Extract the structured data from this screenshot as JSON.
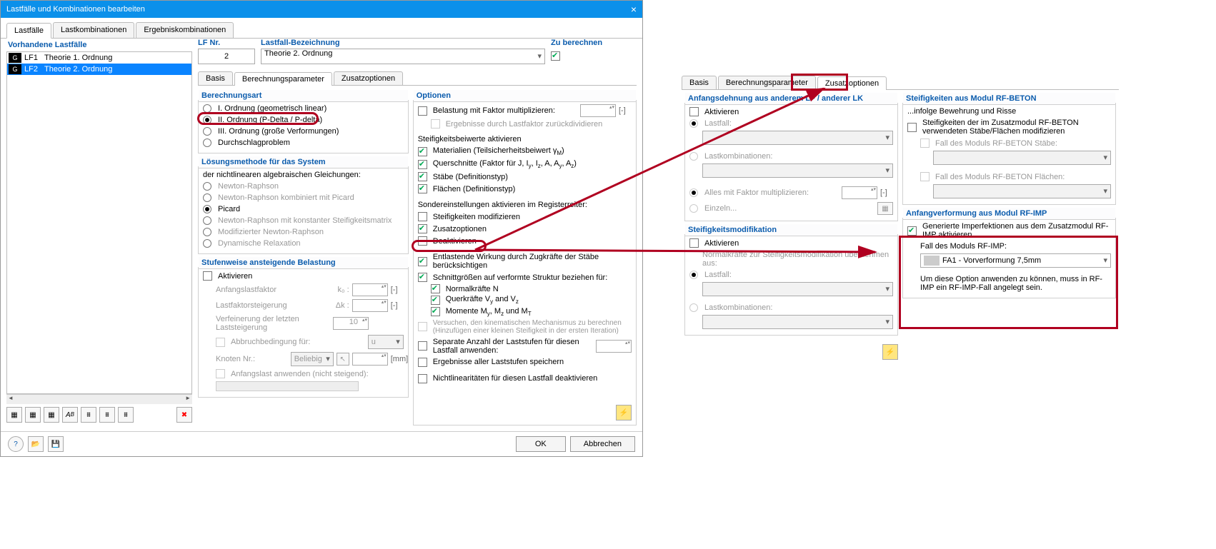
{
  "window": {
    "title": "Lastfälle und Kombinationen bearbeiten"
  },
  "tabs": {
    "t1": "Lastfälle",
    "t2": "Lastkombinationen",
    "t3": "Ergebniskombinationen"
  },
  "left": {
    "title": "Vorhandene Lastfälle",
    "badge": "G",
    "lf1_num": "LF1",
    "lf1_name": "Theorie 1. Ordnung",
    "lf2_num": "LF2",
    "lf2_name": "Theorie 2. Ordnung"
  },
  "hdr": {
    "lfnr_label": "LF Nr.",
    "lfnr_val": "2",
    "bez_label": "Lastfall-Bezeichnung",
    "bez_val": "Theorie 2. Ordnung",
    "zub_label": "Zu berechnen"
  },
  "subtabs": {
    "s1": "Basis",
    "s2": "Berechnungsparameter",
    "s3": "Zusatzoptionen"
  },
  "calc": {
    "legend": "Berechnungsart",
    "r1": "I. Ordnung (geometrisch linear)",
    "r2": "II. Ordnung (P-Delta / P-delta)",
    "r3": "III. Ordnung (große Verformungen)",
    "r4": "Durchschlagproblem"
  },
  "solver": {
    "legend": "Lösungsmethode für das System",
    "intro": "der nichtlinearen algebraischen Gleichungen:",
    "o1": "Newton-Raphson",
    "o2": "Newton-Raphson kombiniert mit Picard",
    "o3": "Picard",
    "o4": "Newton-Raphson mit konstanter Steifigkeitsmatrix",
    "o5": "Modifizierter Newton-Raphson",
    "o6": "Dynamische Relaxation"
  },
  "stuf": {
    "legend": "Stufenweise ansteigende Belastung",
    "act": "Aktivieren",
    "l1": "Anfangslastfaktor",
    "l1s": "k₀ :",
    "l2": "Lastfaktorsteigerung",
    "l2s": "Δk :",
    "l3": "Verfeinerung der letzten Laststeigerung",
    "l3v": "10",
    "l4": "Abbruchbedingung für:",
    "l4v": "u",
    "l5": "Knoten Nr.:",
    "l5v": "Beliebig",
    "l5u": "[mm]",
    "l6": "Anfangslast anwenden (nicht steigend):"
  },
  "opt": {
    "legend": "Optionen",
    "o1": "Belastung mit Faktor multiplizieren:",
    "o1b": "Ergebnisse durch Lastfaktor zurückdividieren",
    "sh": "Steifigkeitsbeiwerte aktivieren",
    "s1": "Materialien (Teilsicherheitsbeiwert γ",
    "s1sub": "M",
    "s1e": ")",
    "s2a": "Querschnitte (Faktor für J, I",
    "s2b": ", A, A",
    "s2c": ")",
    "s3": "Stäbe (Definitionstyp)",
    "s4": "Flächen (Definitionstyp)",
    "sh2": "Sondereinstellungen aktivieren im Registerreiter:",
    "t1": "Steifigkeiten modifizieren",
    "t2": "Zusatzoptionen",
    "t3": "Deaktivieren",
    "e1": "Entlastende Wirkung durch Zugkräfte der Stäbe berücksichtigen",
    "e2": "Schnittgrößen auf verformte Struktur beziehen für:",
    "e2a": "Normalkräfte N",
    "e2b": "Querkräfte V",
    "e2c": "Momente M",
    "e3": "Versuchen, den kinematischen Mechanismus zu berechnen (Hinzufügen einer kleinen Steifigkeit in der ersten Iteration)",
    "e4": "Separate Anzahl der Laststufen für diesen Lastfall anwenden:",
    "e5": "Ergebnisse aller Laststufen speichern",
    "e6": "Nichtlinearitäten für diesen Lastfall deaktivieren"
  },
  "footer": {
    "ok": "OK",
    "cancel": "Abbrechen"
  },
  "side": {
    "t1": "Basis",
    "t2": "Berechnungsparameter",
    "t3": "Zusatzoptionen",
    "g1": {
      "legend": "Anfangsdehnung aus anderem LF / anderer LK",
      "act": "Aktivieren",
      "r1": "Lastfall:",
      "r2": "Lastkombinationen:",
      "r3": "Alles mit Faktor multiplizieren:",
      "r4": "Einzeln..."
    },
    "g2": {
      "legend": "Steifigkeitsmodifikation",
      "act": "Aktivieren",
      "intro": "Normalkräfte zur Steifigkeitsmodifikation übernehmen aus:",
      "r1": "Lastfall:",
      "r2": "Lastkombinationen:"
    },
    "g3": {
      "legend": "Steifigkeiten aus Modul RF-BETON",
      "intro": "...infolge Bewehrung und Risse",
      "c1": "Steifigkeiten der im Zusatzmodul RF-BETON verwendeten Stäbe/Flächen modifizieren",
      "l1": "Fall des Moduls RF-BETON Stäbe:",
      "l2": "Fall des Moduls RF-BETON Flächen:"
    },
    "g4": {
      "legend": "Anfangverformung aus Modul RF-IMP",
      "c1": "Generierte Imperfektionen aus dem Zusatzmodul RF-IMP aktivieren",
      "l1": "Fall des Moduls RF-IMP:",
      "v1": "FA1 - Vorverformung 7,5mm",
      "note": "Um diese Option anwenden zu können, muss in RF-IMP ein RF-IMP-Fall angelegt sein."
    }
  }
}
